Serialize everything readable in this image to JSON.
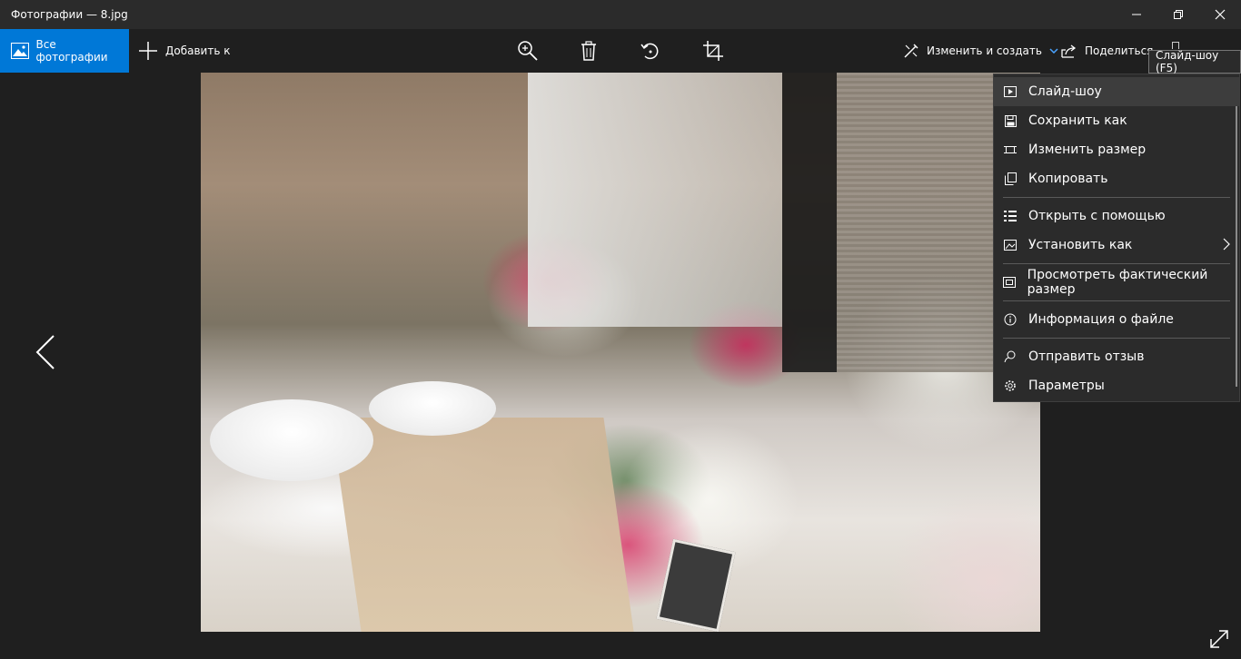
{
  "window": {
    "title": "Фотографии — 8.jpg",
    "controls": [
      "minimize-icon",
      "restore-icon",
      "close-icon"
    ]
  },
  "toolbar": {
    "all_photos_label": "Все фотографии",
    "add_to_label": "Добавить к",
    "center_icons": [
      "zoom-icon",
      "delete-icon",
      "rotate-icon",
      "crop-icon"
    ],
    "edit_create_label": "Изменить и создать",
    "share_label": "Поделиться",
    "accent_color": "#0078d7"
  },
  "tooltip": {
    "text": "Слайд-шоу (F5)"
  },
  "menu": {
    "items": [
      {
        "label": "Слайд-шоу",
        "icon": "slideshow-icon",
        "active": true
      },
      {
        "label": "Сохранить как",
        "icon": "save-icon"
      },
      {
        "label": "Изменить размер",
        "icon": "resize-icon"
      },
      {
        "label": "Копировать",
        "icon": "copy-icon"
      },
      {
        "label": "Открыть с помощью",
        "icon": "open-with-icon"
      },
      {
        "label": "Установить как",
        "icon": "set-as-icon",
        "submenu": true
      },
      {
        "label": "Просмотреть фактический размер",
        "icon": "actual-size-icon"
      },
      {
        "label": "Информация о файле",
        "icon": "info-icon"
      },
      {
        "label": "Отправить отзыв",
        "icon": "feedback-icon"
      },
      {
        "label": "Параметры",
        "icon": "settings-icon"
      }
    ]
  }
}
